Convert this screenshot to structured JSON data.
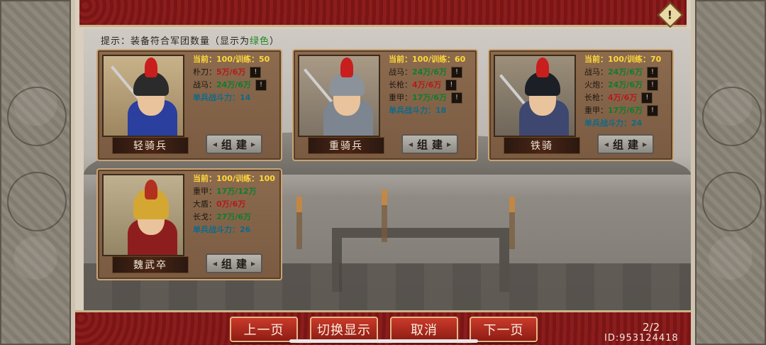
{
  "tip": {
    "prefix": "提示：装备符合军团数量（显示为",
    "highlight": "绿色",
    "suffix": "）"
  },
  "units": [
    {
      "name": "轻骑兵",
      "build_label": "组建",
      "stats": [
        {
          "text": "当前：100/训练：50",
          "style": "yellow",
          "info": false
        },
        {
          "label": "朴刀：",
          "value": "5万/6万",
          "value_style": "red",
          "info": true
        },
        {
          "label": "战马：",
          "value": "24万/6万",
          "value_style": "green",
          "info": true
        },
        {
          "text": "单兵战斗力：14",
          "style": "cyan",
          "info": false
        }
      ]
    },
    {
      "name": "重骑兵",
      "build_label": "组建",
      "stats": [
        {
          "text": "当前：100/训练：60",
          "style": "yellow",
          "info": false
        },
        {
          "label": "战马：",
          "value": "24万/6万",
          "value_style": "green",
          "info": true
        },
        {
          "label": "长枪：",
          "value": "4万/6万",
          "value_style": "red",
          "info": true
        },
        {
          "label": "重甲：",
          "value": "17万/6万",
          "value_style": "green",
          "info": true
        },
        {
          "text": "单兵战斗力：18",
          "style": "cyan",
          "info": false
        }
      ]
    },
    {
      "name": "铁骑",
      "build_label": "组建",
      "stats": [
        {
          "text": "当前：100/训练：70",
          "style": "yellow",
          "info": false
        },
        {
          "label": "战马：",
          "value": "24万/6万",
          "value_style": "green",
          "info": true
        },
        {
          "label": "火炮：",
          "value": "24万/6万",
          "value_style": "green",
          "info": true
        },
        {
          "label": "长枪：",
          "value": "4万/6万",
          "value_style": "red",
          "info": true
        },
        {
          "label": "重甲：",
          "value": "17万/6万",
          "value_style": "green",
          "info": true
        },
        {
          "text": "单兵战斗力：24",
          "style": "cyan",
          "info": false
        }
      ]
    },
    {
      "name": "魏武卒",
      "build_label": "组建",
      "stats": [
        {
          "text": "当前：100/训练：100",
          "style": "yellow",
          "info": false
        },
        {
          "label": "重甲：",
          "value": "17万/12万",
          "value_style": "green",
          "info": false
        },
        {
          "label": "大盾：",
          "value": "0万/6万",
          "value_style": "red",
          "info": false
        },
        {
          "label": "长戈：",
          "value": "27万/6万",
          "value_style": "green",
          "info": false
        },
        {
          "text": "单兵战斗力：26",
          "style": "cyan",
          "info": false
        }
      ]
    }
  ],
  "info_button_label": "!",
  "warning_icon_label": "!",
  "nav": {
    "prev": "上一页",
    "toggle": "切换显示",
    "cancel": "取消",
    "next": "下一页"
  },
  "page_indicator": "2/2",
  "player_id": "ID:953124418",
  "colors": {
    "frame_red": "#8b1d1d",
    "card_brown": "#8c6b4e",
    "sufficient_green": "#0d7d2d",
    "insufficient_red": "#b51a1a",
    "current_yellow": "#ffd83a"
  },
  "portrait_icons": [
    "light-cavalry-portrait",
    "heavy-cavalry-portrait",
    "iron-cavalry-portrait",
    "wei-infantry-portrait"
  ]
}
